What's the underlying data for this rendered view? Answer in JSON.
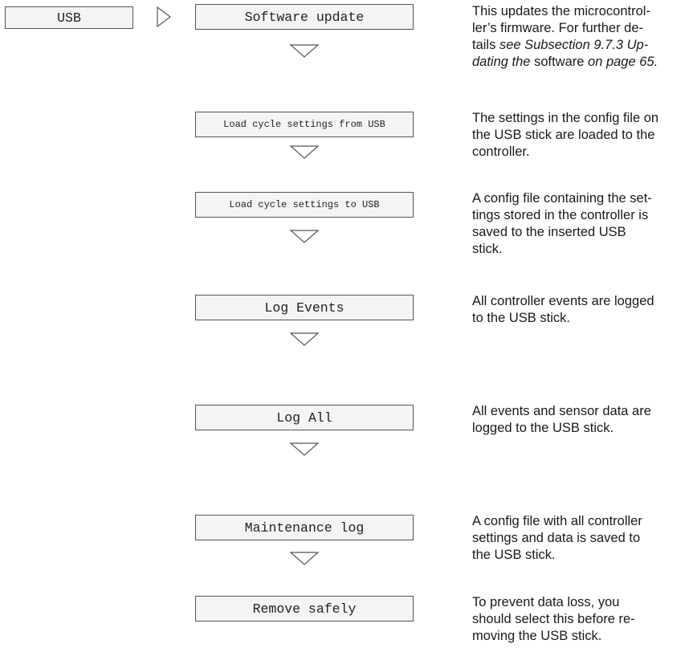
{
  "menu_root": {
    "label": "USB"
  },
  "items": [
    {
      "label": "Software update",
      "desc_lines": [
        "This updates the microcontrol-",
        "ler’s firmware. For further de-",
        "tails ",
        "see Subsection 9.7.3 Up-",
        "dating the",
        " software ",
        "on page 65."
      ]
    },
    {
      "label": "Load cycle settings from USB",
      "desc_lines": [
        "The settings in the config file on",
        "the USB stick are loaded to the",
        "controller."
      ]
    },
    {
      "label": "Load cycle settings to USB",
      "desc_lines": [
        "A config file containing the set-",
        "tings stored in the controller is",
        "saved to the inserted USB",
        "stick."
      ]
    },
    {
      "label": "Log Events",
      "desc_lines": [
        "All controller events are logged",
        "to the USB stick."
      ]
    },
    {
      "label": "Log All",
      "desc_lines": [
        "All events and sensor data are",
        "logged to the USB stick."
      ]
    },
    {
      "label": "Maintenance log",
      "desc_lines": [
        "A config file with all controller",
        "settings and data is saved to",
        "the USB stick."
      ]
    },
    {
      "label": "Remove safely",
      "desc_lines": [
        "To prevent data loss, you",
        "should select this before re-",
        "moving the USB stick."
      ]
    }
  ]
}
